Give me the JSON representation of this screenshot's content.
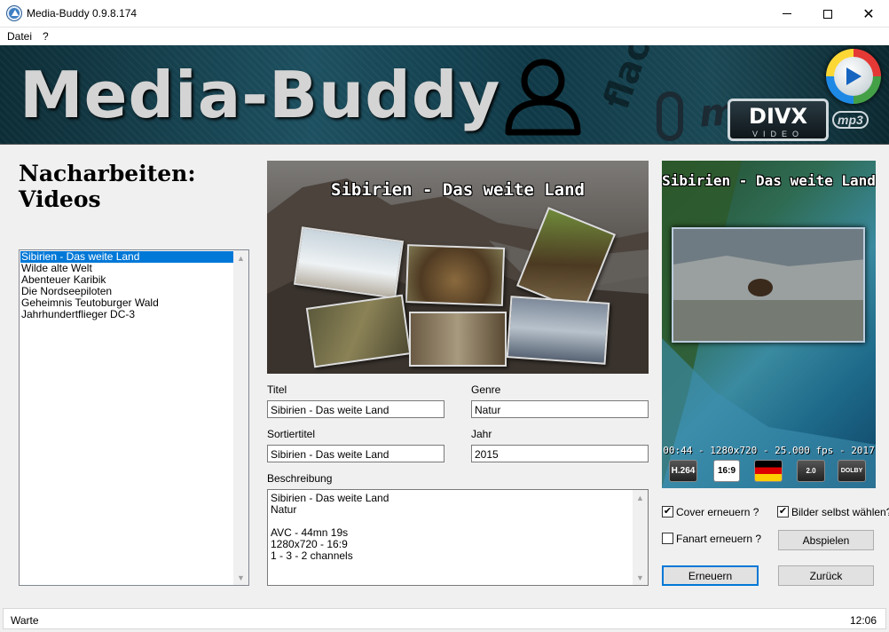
{
  "window": {
    "title": "Media-Buddy 0.9.8.174"
  },
  "menu": {
    "items": [
      "Datei",
      "?"
    ]
  },
  "banner": {
    "title": "Media-Buddy",
    "logos": {
      "flac": "flac",
      "mpeg": "mpeg",
      "divx": "DIVX",
      "divx_sub": "VIDEO",
      "mp3": "mp3"
    }
  },
  "heading": {
    "line1": "Nacharbeiten:",
    "line2": "Videos"
  },
  "video_list": {
    "items": [
      "Sibirien - Das weite Land",
      "Wilde alte Welt",
      "Abenteuer Karibik",
      "Die Nordseepiloten",
      "Geheimnis Teutoburger Wald",
      "Jahrhundertflieger DC-3"
    ],
    "selected_index": 0
  },
  "poster": {
    "title": "Sibirien - Das weite Land"
  },
  "form": {
    "titel_label": "Titel",
    "titel_value": "Sibirien - Das weite Land",
    "genre_label": "Genre",
    "genre_value": "Natur",
    "sortiertitel_label": "Sortiertitel",
    "sortiertitel_value": "Sibirien - Das weite Land",
    "jahr_label": "Jahr",
    "jahr_value": "2015",
    "beschreibung_label": "Beschreibung",
    "beschreibung_lines": [
      "Sibirien - Das weite Land",
      "Natur",
      "",
      "AVC - 44mn 19s",
      "1280x720 - 16:9",
      "1 - 3 - 2 channels"
    ]
  },
  "fanart": {
    "title": "Sibirien - Das weite Land",
    "info": "00:44 - 1280x720 - 25.000 fps - 2017",
    "icons": {
      "codec": "H.264",
      "aspect": "16:9",
      "audio_channels": "2.0",
      "dolby": "DOLBY"
    }
  },
  "options": {
    "cover_label": "Cover erneuern ?",
    "cover_checked": true,
    "bilder_label": "Bilder selbst wählen?",
    "bilder_checked": true,
    "fanart_label": "Fanart erneuern ?",
    "fanart_checked": false
  },
  "buttons": {
    "abspielen": "Abspielen",
    "erneuern": "Erneuern",
    "zurueck": "Zurück"
  },
  "status": {
    "text": "Warte",
    "time": "12:06"
  },
  "colors": {
    "selection": "#0078d7",
    "default_button_border": "#0078d7"
  }
}
